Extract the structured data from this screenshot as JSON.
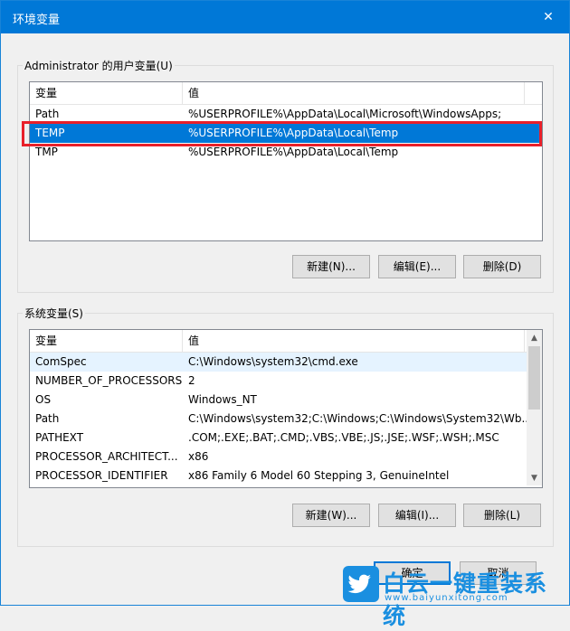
{
  "window": {
    "title": "环境变量",
    "close_glyph": "✕"
  },
  "user_vars": {
    "group_label": "Administrator 的用户变量(U)",
    "col_name": "变量",
    "col_value": "值",
    "rows": [
      {
        "name": "Path",
        "value": "%USERPROFILE%\\AppData\\Local\\Microsoft\\WindowsApps;"
      },
      {
        "name": "TEMP",
        "value": "%USERPROFILE%\\AppData\\Local\\Temp"
      },
      {
        "name": "TMP",
        "value": "%USERPROFILE%\\AppData\\Local\\Temp"
      }
    ],
    "selected_row": "TEMP",
    "buttons": {
      "new": "新建(N)...",
      "edit": "编辑(E)...",
      "delete": "删除(D)"
    }
  },
  "system_vars": {
    "group_label": "系统变量(S)",
    "col_name": "变量",
    "col_value": "值",
    "rows": [
      {
        "name": "ComSpec",
        "value": "C:\\Windows\\system32\\cmd.exe"
      },
      {
        "name": "NUMBER_OF_PROCESSORS",
        "value": "2"
      },
      {
        "name": "OS",
        "value": "Windows_NT"
      },
      {
        "name": "Path",
        "value": "C:\\Windows\\system32;C:\\Windows;C:\\Windows\\System32\\Wb..."
      },
      {
        "name": "PATHEXT",
        "value": ".COM;.EXE;.BAT;.CMD;.VBS;.VBE;.JS;.JSE;.WSF;.WSH;.MSC"
      },
      {
        "name": "PROCESSOR_ARCHITECT...",
        "value": "x86"
      },
      {
        "name": "PROCESSOR_IDENTIFIER",
        "value": "x86 Family 6 Model 60 Stepping 3, GenuineIntel"
      }
    ],
    "buttons": {
      "new": "新建(W)...",
      "edit": "编辑(I)...",
      "delete": "删除(L)"
    }
  },
  "footer": {
    "ok": "确定",
    "cancel": "取消"
  },
  "watermark": {
    "text": "白云一键重装系统",
    "url": "www.baiyunxitong.com"
  },
  "colors": {
    "accent": "#0078d7",
    "highlight_border": "#e8202a",
    "watermark": "#1a8fe0"
  }
}
